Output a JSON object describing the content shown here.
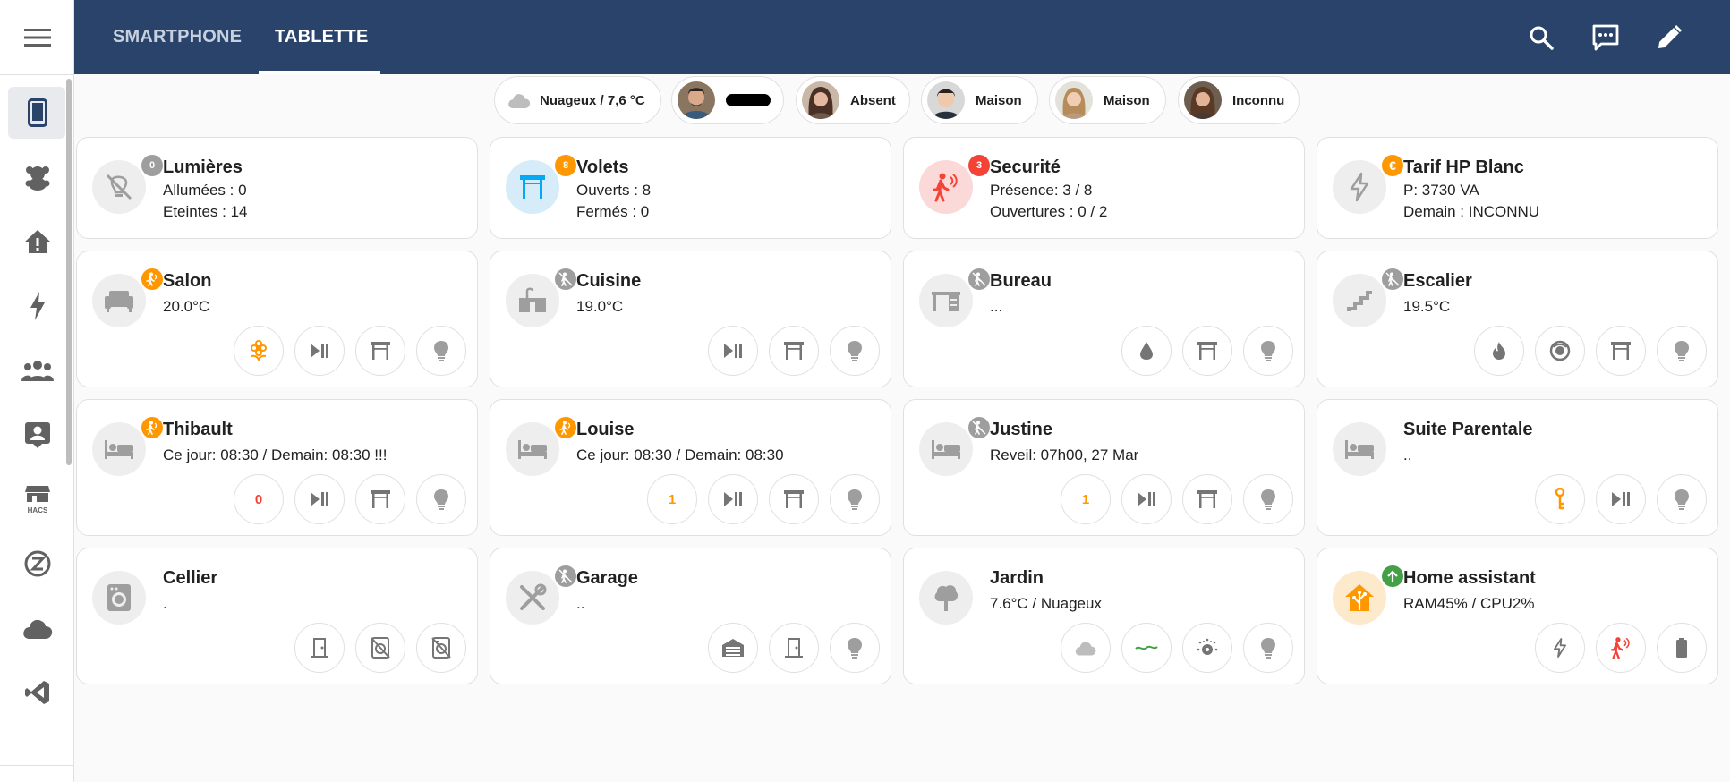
{
  "tabs": [
    {
      "label": "SMARTPHONE"
    },
    {
      "label": "TABLETTE"
    }
  ],
  "chips": [
    {
      "label": "Nuageux / 7,6 °C",
      "icon": "cloud-icon"
    },
    {
      "label": "",
      "icon": "avatar"
    },
    {
      "label": "Absent",
      "icon": "avatar"
    },
    {
      "label": "Maison",
      "icon": "avatar"
    },
    {
      "label": "Maison",
      "icon": "avatar"
    },
    {
      "label": "Inconnu",
      "icon": "avatar"
    }
  ],
  "cards": [
    {
      "name": "Lumières",
      "lines": [
        "Allumées : 0",
        "Eteintes : 14"
      ],
      "badge": "0"
    },
    {
      "name": "Volets",
      "lines": [
        "Ouverts : 8",
        "Fermés : 0"
      ],
      "badge": "8"
    },
    {
      "name": "Securité",
      "lines": [
        "Présence: 3 / 8",
        "Ouvertures : 0 / 2"
      ],
      "badge": "3"
    },
    {
      "name": "Tarif HP Blanc",
      "lines": [
        "P: 3730 VA",
        "Demain : INCONNU"
      ],
      "badge": "€"
    },
    {
      "name": "Salon",
      "lines": [
        "20.0°C"
      ]
    },
    {
      "name": "Cuisine",
      "lines": [
        "19.0°C"
      ]
    },
    {
      "name": "Bureau",
      "lines": [
        "..."
      ]
    },
    {
      "name": "Escalier",
      "lines": [
        "19.5°C"
      ]
    },
    {
      "name": "Thibault",
      "lines": [
        "Ce jour: 08:30 / Demain: 08:30 !!!"
      ],
      "btn_text": "0"
    },
    {
      "name": "Louise",
      "lines": [
        "Ce jour: 08:30 / Demain: 08:30"
      ],
      "btn_text": "1"
    },
    {
      "name": "Justine",
      "lines": [
        "Reveil: 07h00, 27 Mar"
      ],
      "btn_text": "1"
    },
    {
      "name": "Suite Parentale",
      "lines": [
        ".."
      ]
    },
    {
      "name": "Cellier",
      "lines": [
        "."
      ]
    },
    {
      "name": "Garage",
      "lines": [
        ".."
      ]
    },
    {
      "name": "Jardin",
      "lines": [
        "7.6°C / Nuageux"
      ]
    },
    {
      "name": "Home assistant",
      "lines": [
        "RAM45% / CPU2%"
      ]
    }
  ],
  "colors": {
    "header": "#29436b",
    "accent_orange": "#ff9800",
    "accent_red": "#f44336",
    "accent_green": "#43a047",
    "accent_blue": "#03a9f4"
  }
}
